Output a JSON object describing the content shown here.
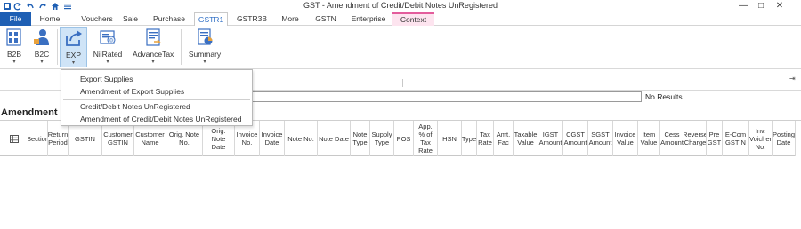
{
  "window": {
    "title": "GST - Amendment of Credit/Debit Notes UnRegistered",
    "controls": {
      "minimize": "—",
      "restore": "□",
      "close": "✕"
    }
  },
  "quick_access": [
    "app-icon",
    "refresh-icon",
    "undo-icon",
    "redo-icon",
    "home-icon",
    "menu-icon"
  ],
  "tabs": [
    {
      "label": "File"
    },
    {
      "label": "Home"
    },
    {
      "label": "Vouchers"
    },
    {
      "label": "Sale"
    },
    {
      "label": "Purchase"
    },
    {
      "label": "GSTR1"
    },
    {
      "label": "GSTR3B"
    },
    {
      "label": "More"
    },
    {
      "label": "GSTN"
    },
    {
      "label": "Enterprise"
    },
    {
      "label": "Context"
    }
  ],
  "ribbon": {
    "b2b": "B2B",
    "b2c": "B2C",
    "exp": "EXP",
    "nilrated": "NilRated",
    "advancetax": "AdvanceTax",
    "summary": "Summary"
  },
  "menu": {
    "items": [
      "Export Supplies",
      "Amendment of Export Supplies",
      "Credit/Debit Notes UnRegistered",
      "Amendment of Credit/Debit Notes UnRegistered"
    ]
  },
  "search": {
    "value": "",
    "results": "No Results"
  },
  "section": {
    "title": "Amendment of Credit/Debit Notes UnRegistered"
  },
  "table": {
    "columns": [
      "Section",
      "Return Period",
      "GSTIN",
      "Customer GSTIN",
      "Customer Name",
      "Orig. Note No.",
      "Orig. Note Date",
      "Invoice No.",
      "Invoice Date",
      "Note No.",
      "Note Date",
      "Note Type",
      "Supply Type",
      "POS",
      "App. % of Tax Rate",
      "HSN",
      "Type",
      "Tax Rate",
      "Amt. Fac",
      "Taxable Value",
      "IGST Amount",
      "CGST Amount",
      "SGST Amount",
      "Invoice Value",
      "Item Value",
      "Cess Amount",
      "Reverse Charge",
      "Pre GST",
      "E-Com GSTIN",
      "Inv. Voicher No.",
      "Posting Date"
    ]
  },
  "colors": {
    "file_tab": "#1e5fb4",
    "active_tab_text": "#2b6cc4",
    "context_tab_bg": "#fde4ef",
    "context_tab_border": "#e35c9c",
    "selected_button_bg": "#cfe4f7"
  }
}
